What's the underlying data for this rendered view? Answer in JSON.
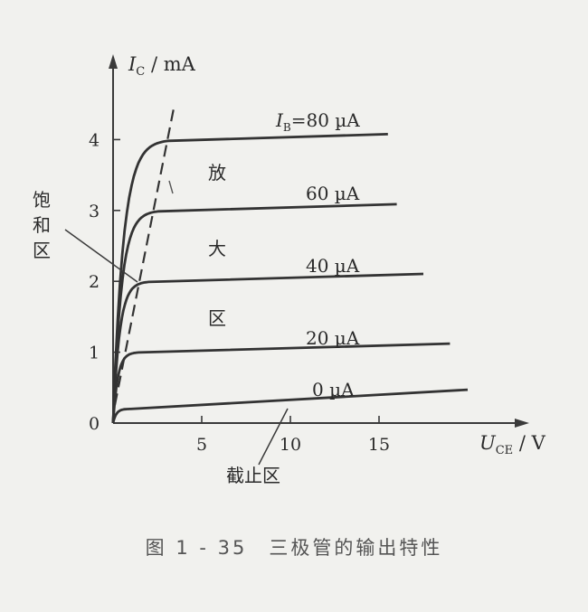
{
  "chart_data": {
    "type": "line",
    "ylabel": {
      "var": "I",
      "sub": "C",
      "unit": "/ mA"
    },
    "xlabel": {
      "var": "U",
      "sub": "CE",
      "unit": "/ V"
    },
    "xticks": [
      "5",
      "10",
      "15"
    ],
    "yticks": [
      "0",
      "1",
      "2",
      "3",
      "4"
    ],
    "xlim": [
      0,
      22
    ],
    "ylim": [
      0,
      5
    ],
    "series": [
      {
        "name": "80 µA",
        "label_prefix": {
          "var": "I",
          "sub": "B",
          "eq": "="
        },
        "sat": 4.0,
        "end": 15.5,
        "slope": 0.006
      },
      {
        "name": "60 µA",
        "sat": 3.0,
        "end": 16.0,
        "slope": 0.006
      },
      {
        "name": "40 µA",
        "sat": 2.0,
        "end": 17.5,
        "slope": 0.006
      },
      {
        "name": "20 µA",
        "sat": 1.0,
        "end": 19.0,
        "slope": 0.006
      },
      {
        "name": "0 µA",
        "sat": 0.2,
        "end": 20.0,
        "slope": 0.008
      }
    ],
    "regions": {
      "active": [
        "放",
        "大",
        "区"
      ],
      "saturation": [
        "饱",
        "和",
        "区"
      ],
      "cutoff": "截止区"
    }
  },
  "caption": "图 1 - 35　三极管的输出特性"
}
